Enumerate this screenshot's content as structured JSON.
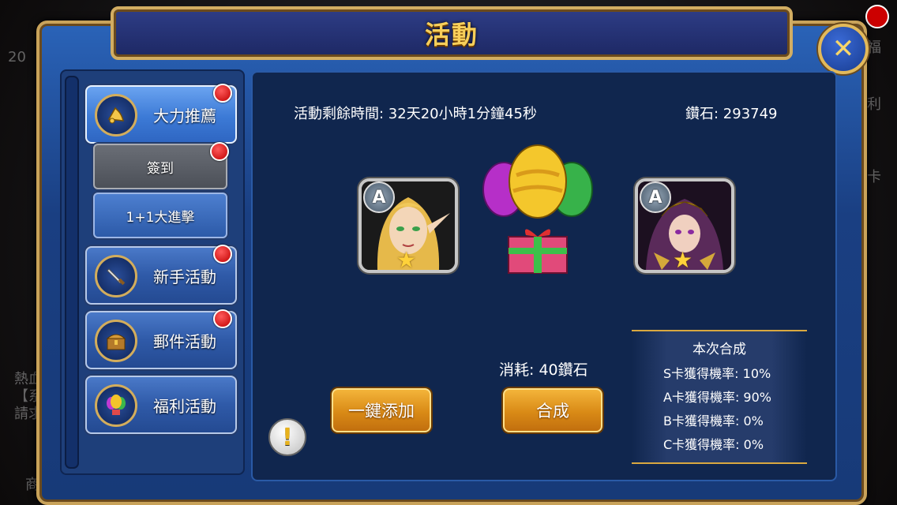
{
  "title": "活動",
  "sidebar": {
    "items": [
      {
        "label": "大力推薦",
        "icon": "horn-icon",
        "badge": true
      },
      {
        "label": "簽到",
        "badge": true
      },
      {
        "label": "1+1大進擊",
        "badge": false
      },
      {
        "label": "新手活動",
        "icon": "sword-icon",
        "badge": true
      },
      {
        "label": "郵件活動",
        "icon": "chest-icon",
        "badge": true
      },
      {
        "label": "福利活動",
        "icon": "balloon-icon",
        "badge": false
      }
    ]
  },
  "main": {
    "timer_text": "活動剩餘時間: 32天20小時1分鐘45秒",
    "diamond_text": "鑽石: 293749",
    "cards": [
      {
        "rank": "A",
        "stars": 1,
        "portrait": "elf-portrait"
      },
      {
        "rank": "A",
        "stars": 1,
        "portrait": "warrior-portrait"
      }
    ],
    "cost_text": "消耗: 40鑽石",
    "add_button": "一鍵添加",
    "compose_button": "合成",
    "rates": {
      "title": "本次合成",
      "lines": [
        "S卡獲得機率: 10%",
        "A卡獲得機率: 90%",
        "B卡獲得機率: 0%",
        "C卡獲得機率: 0%"
      ]
    }
  },
  "background": {
    "level": "20",
    "side_text_left": [
      "熱血",
      "【系",
      "請求"
    ],
    "side_text_right": [
      "福",
      "利",
      "卡"
    ],
    "bottom_left": "商"
  },
  "colors": {
    "frame_gold": "#c9a35a",
    "panel_blue": "#10264e",
    "button_gold": "#f3b43a",
    "title_gold": "#f7cf5a"
  }
}
